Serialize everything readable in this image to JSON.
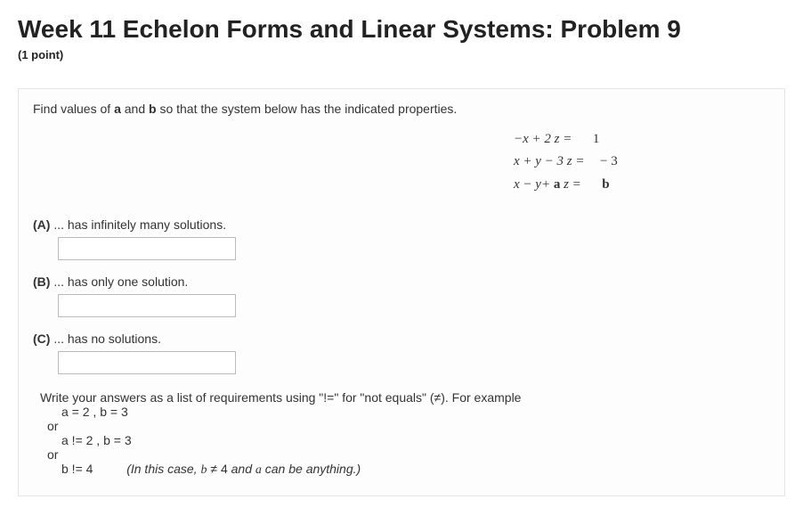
{
  "header": {
    "title": "Week 11 Echelon Forms and Linear Systems: Problem 9",
    "subtitle": "(1 point)"
  },
  "problem": {
    "prompt_pre": "Find values of ",
    "prompt_a": "a",
    "prompt_mid": " and ",
    "prompt_b": "b",
    "prompt_post": " so that the system below has the indicated properties.",
    "equations": {
      "row1_lhs": "−x        + 2 z  =",
      "row1_rhs": "1",
      "row2_lhs": "x + y − 3 z  =",
      "row2_rhs": "− 3",
      "row3_lhs_pre": "x − y+ ",
      "row3_a": "a",
      "row3_lhs_post": " z  =",
      "row3_rhs": "b"
    },
    "parts": {
      "A": {
        "tag": "(A)",
        "text": " ... has infinitely many solutions."
      },
      "B": {
        "tag": "(B)",
        "text": " ... has only one solution."
      },
      "C": {
        "tag": "(C)",
        "text": " ... has no solutions."
      }
    },
    "hints": {
      "line1": "Write your answers as a list of requirements using \"!=\" for \"not equals\" (≠). For example",
      "ex1": "a = 2 , b = 3",
      "or": "or",
      "ex2": "a != 2 , b = 3",
      "ex3_pre": "b != 4",
      "ex3_note_pre": "(In this case, ",
      "ex3_note_b": "b",
      "ex3_note_ne": " ≠ ",
      "ex3_note_4": "4",
      "ex3_note_mid": " and ",
      "ex3_note_a": "a",
      "ex3_note_post": " can be anything.)"
    }
  }
}
